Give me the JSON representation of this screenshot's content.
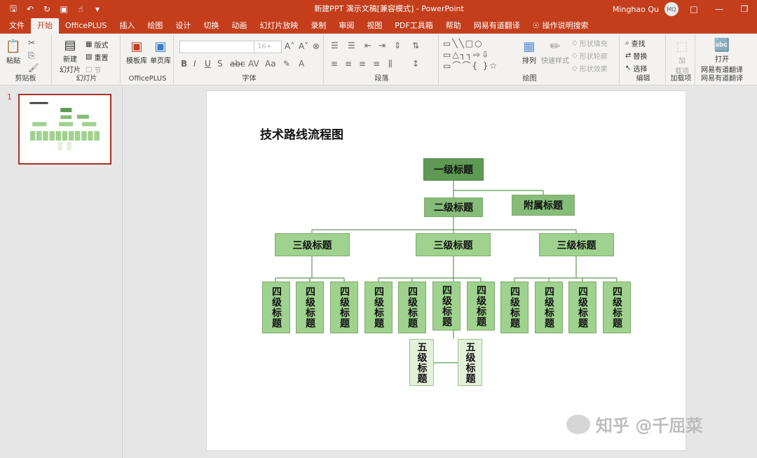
{
  "window": {
    "title": "新建PPT 演示文稿[兼容模式] - PowerPoint",
    "user": "Minghao Qu",
    "avatar_initials": "MQ"
  },
  "tabs": [
    "文件",
    "开始",
    "OfficePLUS",
    "插入",
    "绘图",
    "设计",
    "切换",
    "动画",
    "幻灯片放映",
    "录制",
    "审阅",
    "视图",
    "PDF工具箱",
    "帮助",
    "网易有道翻译",
    "操作说明搜索"
  ],
  "active_tab": "开始",
  "ribbon": {
    "clipboard": {
      "label": "剪贴板",
      "paste": "粘贴"
    },
    "slides": {
      "label": "幻灯片",
      "new_slide": "新建\n幻灯片",
      "layout": "版式",
      "reset": "重置",
      "section": "节"
    },
    "officeplus": {
      "label": "OfficePLUS",
      "template": "模板库",
      "single": "单页库"
    },
    "font": {
      "label": "字体",
      "size": "16+"
    },
    "paragraph": {
      "label": "段落"
    },
    "drawing": {
      "label": "绘图",
      "arrange": "排列",
      "quick_style": "快速样式",
      "fill": "形状填充",
      "outline": "形状轮廓",
      "effect": "形状效果"
    },
    "editing": {
      "label": "编辑",
      "find": "查找",
      "replace": "替换",
      "select": "选择"
    },
    "addins": {
      "label": "加载项",
      "add": "加\n载项"
    },
    "youdao": {
      "label": "网易有道翻译",
      "open": "打开\n网易有道翻译"
    }
  },
  "thumbnail": {
    "number": "1"
  },
  "slide": {
    "title": "技术路线流程图",
    "level1": "一级标题",
    "level2": "二级标题",
    "attached": "附属标题",
    "level3": [
      "三级标题",
      "三级标题",
      "三级标题"
    ],
    "level4": [
      "四级标题",
      "四级标题",
      "四级标题",
      "四级标题",
      "四级标题",
      "四级标题",
      "四级标题",
      "四级标题",
      "四级标题",
      "四级标题",
      "四级标题"
    ],
    "level5": [
      "五级标题",
      "五级标题"
    ]
  },
  "watermark": "知乎 @千屈菜",
  "colors": {
    "accent": "#c43e1c",
    "level1": "#5e9a53",
    "level2": "#86bc77",
    "level3": "#9fd28e",
    "level5": "#e3f1db"
  }
}
